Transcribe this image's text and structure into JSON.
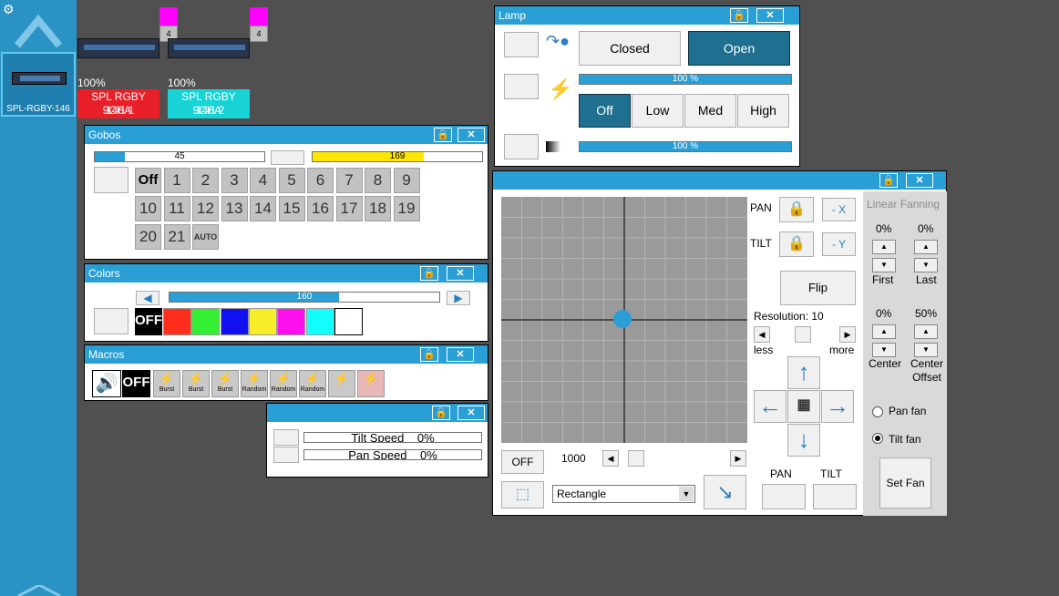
{
  "sidebar": {
    "selected_label": "SPL-RGBY-146"
  },
  "fixtures": [
    {
      "percent": "100%",
      "name": "SPL RGBY 146A",
      "mode": "9CH-1",
      "badge": "4",
      "color": "#e81f28"
    },
    {
      "percent": "100%",
      "name": "SPL RGBY 146A",
      "mode": "9CH-2",
      "badge": "4",
      "color": "#18d3d6"
    }
  ],
  "lamp": {
    "title": "Lamp",
    "closed_label": "Closed",
    "open_label": "Open",
    "power_value": "100 %",
    "power_level": 1.0,
    "fan_levels": [
      "Off",
      "Low",
      "Med",
      "High"
    ],
    "fan_selected": "Off",
    "dimmer_value": "100 %",
    "dimmer_level": 1.0
  },
  "gobos": {
    "title": "Gobos",
    "value_left": "45",
    "value_left_level": 0.18,
    "value_right": "169",
    "buttons": [
      "Off",
      "1",
      "2",
      "3",
      "4",
      "5",
      "6",
      "7",
      "8",
      "9",
      "10",
      "11",
      "12",
      "13",
      "14",
      "15",
      "16",
      "17",
      "18",
      "19",
      "20",
      "21",
      "AUTO"
    ]
  },
  "colors": {
    "title": "Colors",
    "value": "160",
    "value_level": 0.63,
    "off_label": "OFF",
    "swatches": [
      "#ff2e1a",
      "#33ee33",
      "#1010f0",
      "#f7ed29",
      "#ff11ee",
      "#11ffff",
      "#ffffff"
    ]
  },
  "macros": {
    "title": "Macros",
    "off_label": "OFF",
    "items": [
      "Burst",
      "Burst",
      "Burst",
      "Random",
      "Random",
      "Random",
      "",
      ""
    ]
  },
  "speed": {
    "tilt_label": "Tilt Speed",
    "tilt_value": "0%",
    "pan_label": "Pan Speed",
    "pan_value": "0%"
  },
  "movement": {
    "pan_label": "PAN",
    "tilt_label": "TILT",
    "pan_x_btn": "- X",
    "tilt_y_btn": "- Y",
    "flip_label": "Flip",
    "resolution_label": "Resolution: 10",
    "less_label": "less",
    "more_label": "more",
    "off_btn": "OFF",
    "speed_value": "1000",
    "shape_selected": "Rectangle",
    "pan_bottom_label": "PAN",
    "tilt_bottom_label": "TILT"
  },
  "fanning": {
    "title": "Linear Fanning",
    "first_value": "0%",
    "last_value": "0%",
    "first_label": "First",
    "last_label": "Last",
    "center_value": "0%",
    "center_offset_value": "50%",
    "center_label": "Center",
    "center_offset_label": "Center Offset",
    "pan_fan_label": "Pan fan",
    "tilt_fan_label": "Tilt fan",
    "set_fan_label": "Set Fan"
  }
}
